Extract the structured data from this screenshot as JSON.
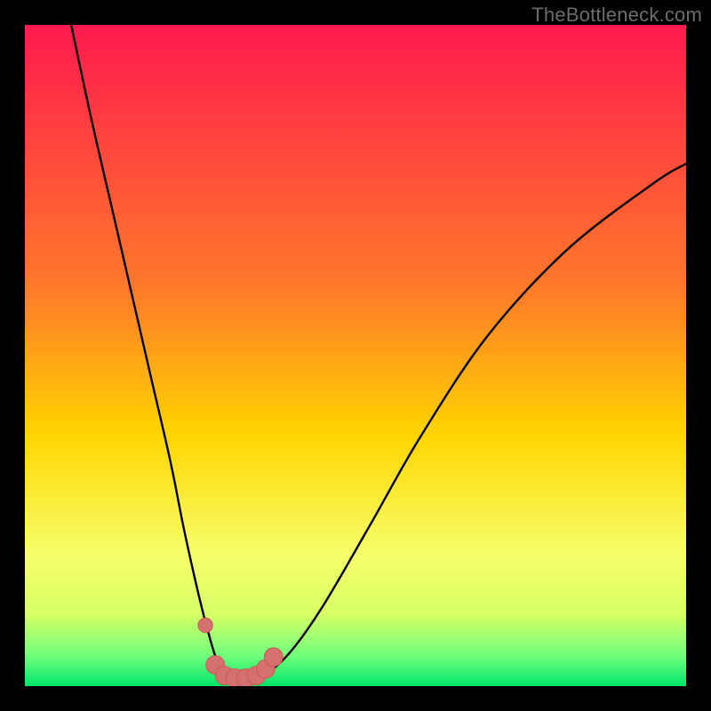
{
  "watermark": "TheBottleneck.com",
  "colors": {
    "frame": "#000000",
    "grad_top": "#ff1a4e",
    "grad_mid1": "#ff7a2a",
    "grad_mid2": "#ffd500",
    "grad_low": "#f7ff6a",
    "grad_band": "#d8ff66",
    "grad_bottom1": "#6fff7a",
    "grad_bottom2": "#00e66a",
    "curve": "#000000",
    "marker_fill": "#d4716e",
    "marker_stroke": "#c85a57"
  },
  "chart_data": {
    "type": "line",
    "title": "",
    "xlabel": "",
    "ylabel": "",
    "xlim": [
      0,
      100
    ],
    "ylim": [
      0,
      100
    ],
    "series": [
      {
        "name": "bottleneck-curve",
        "x": [
          7,
          10,
          13,
          16,
          19,
          22,
          24,
          26,
          27.5,
          29,
          30.5,
          32,
          34,
          36,
          40,
          45,
          52,
          60,
          70,
          82,
          95,
          100
        ],
        "y": [
          100,
          86,
          73,
          60,
          47,
          34,
          24,
          15,
          9,
          4,
          1.5,
          1,
          1,
          1.5,
          5,
          12,
          24,
          38,
          53,
          66,
          76,
          79
        ]
      }
    ],
    "markers": [
      {
        "x": 27.3,
        "y": 9.2,
        "r": 1.1
      },
      {
        "x": 28.8,
        "y": 3.2,
        "r": 1.4
      },
      {
        "x": 30.2,
        "y": 1.6,
        "r": 1.4
      },
      {
        "x": 31.8,
        "y": 1.2,
        "r": 1.4
      },
      {
        "x": 33.4,
        "y": 1.2,
        "r": 1.4
      },
      {
        "x": 35.0,
        "y": 1.6,
        "r": 1.4
      },
      {
        "x": 36.4,
        "y": 2.6,
        "r": 1.4
      },
      {
        "x": 37.6,
        "y": 4.4,
        "r": 1.4
      }
    ],
    "gradient_stops": [
      {
        "pos": 0.0,
        "key": "grad_top"
      },
      {
        "pos": 0.4,
        "key": "grad_mid1"
      },
      {
        "pos": 0.62,
        "key": "grad_mid2"
      },
      {
        "pos": 0.8,
        "key": "grad_low"
      },
      {
        "pos": 0.89,
        "key": "grad_band"
      },
      {
        "pos": 0.955,
        "key": "grad_bottom1"
      },
      {
        "pos": 1.0,
        "key": "grad_bottom2"
      }
    ]
  }
}
